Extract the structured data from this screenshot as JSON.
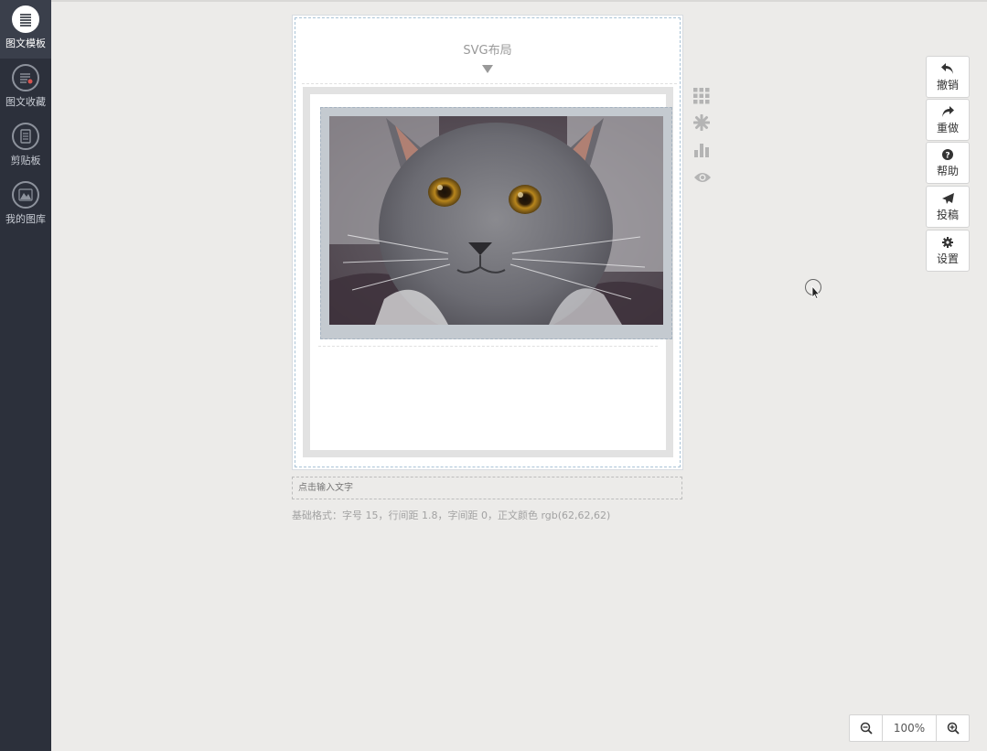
{
  "sidebar": {
    "items": [
      {
        "label": "图文模板",
        "icon": "list-icon",
        "active": true
      },
      {
        "label": "图文收藏",
        "icon": "favorite-list-icon",
        "active": false
      },
      {
        "label": "剪贴板",
        "icon": "clipboard-icon",
        "active": false
      },
      {
        "label": "我的图库",
        "icon": "gallery-icon",
        "active": false
      }
    ]
  },
  "editor": {
    "svg_title": "SVG布局",
    "image_alt": "gray cat photo"
  },
  "tools": [
    {
      "icon": "grid-icon"
    },
    {
      "icon": "burst-icon"
    },
    {
      "icon": "bar-chart-icon"
    },
    {
      "icon": "eye-icon"
    }
  ],
  "text_input": {
    "placeholder": "点击输入文字"
  },
  "base_format": "基础格式：字号 15，行间距 1.8，字间距 0，正文颜色 rgb(62,62,62)",
  "right_panel": [
    {
      "label": "撤销",
      "icon": "undo-icon"
    },
    {
      "label": "重做",
      "icon": "redo-icon"
    },
    {
      "label": "帮助",
      "icon": "help-icon"
    },
    {
      "label": "投稿",
      "icon": "send-icon"
    },
    {
      "label": "设置",
      "icon": "gear-icon"
    }
  ],
  "zoom": {
    "value": "100%"
  },
  "colors": {
    "sidebar_bg": "#2c303b",
    "canvas_bg": "#ecebe9",
    "accent_dash": "#a9c3d6"
  }
}
